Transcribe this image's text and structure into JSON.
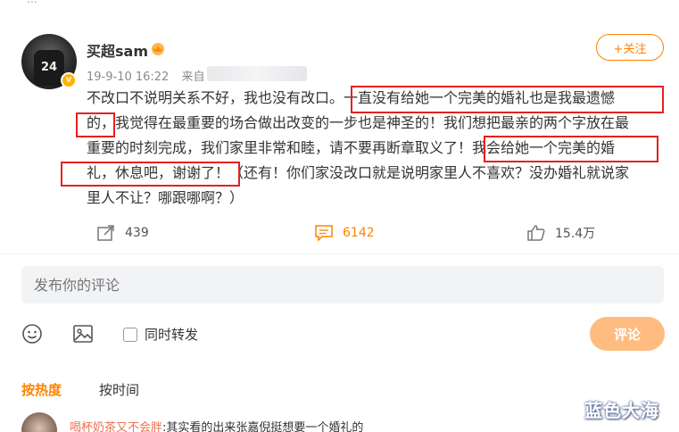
{
  "post": {
    "username": "买超sam",
    "timestamp": "19-9-10 16:22",
    "source_label": "来自",
    "follow_label": "+关注",
    "lines": [
      [
        "不改口不说明关系不好，我也没有改口。",
        "一直没有给她一个完美的婚礼也是我最遗憾"
      ],
      [
        "的，",
        "我觉得在最重要的场合做出改变的一步也是神圣的！我们想把最亲的两个字放在最"
      ],
      [
        "重要的时刻完成，我们家里非常和睦，请不要再断章取义了！",
        "我会给她一个完美的婚"
      ],
      [
        "礼，休息吧，谢谢了！",
        "（还有！你们家没改口就是说明家里人不喜欢？没办婚礼就说家"
      ],
      [
        "里人不让？哪跟哪啊？）"
      ]
    ]
  },
  "actions": {
    "repost_count": "439",
    "comment_count": "6142",
    "like_count": "15.4万"
  },
  "comment_box": {
    "placeholder": "发布你的评论",
    "repost_label": "同时转发",
    "submit_label": "评论"
  },
  "sort": {
    "hot_label": "按热度",
    "time_label": "按时间"
  },
  "top_comment": {
    "user": "喝杯奶茶又不会胖",
    "text": ":其实看的出来张嘉倪挺想要一个婚礼的"
  },
  "watermark": "蓝色大海",
  "colors": {
    "accent": "#ff8200",
    "highlight_box": "#e62020",
    "submit_disabled": "#ffbc80"
  }
}
